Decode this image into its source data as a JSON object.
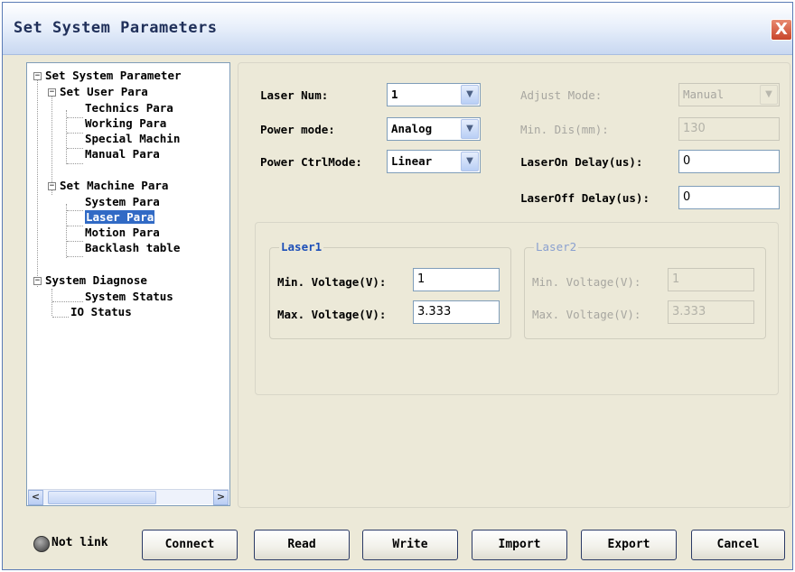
{
  "window": {
    "title": "Set System Parameters",
    "close_glyph": "X"
  },
  "tree": {
    "items": [
      {
        "label": "Set System Parameter"
      },
      {
        "label": "Set User Para"
      },
      {
        "label": "Technics Para"
      },
      {
        "label": "Working Para"
      },
      {
        "label": "Special Machin"
      },
      {
        "label": "Manual Para"
      },
      {
        "label": "Set Machine Para"
      },
      {
        "label": "System Para"
      },
      {
        "label": "Laser Para"
      },
      {
        "label": "Motion Para"
      },
      {
        "label": "Backlash table"
      },
      {
        "label": "System Diagnose"
      },
      {
        "label": "System Status"
      },
      {
        "label": "IO Status"
      }
    ],
    "selected": "Laser Para",
    "expander_glyph": "−",
    "scroll_left": "<",
    "scroll_right": ">"
  },
  "params": {
    "laser_num": {
      "label": "Laser Num:",
      "value": "1"
    },
    "power_mode": {
      "label": "Power mode:",
      "value": "Analog"
    },
    "power_ctrl_mode": {
      "label": "Power CtrlMode:",
      "value": "Linear"
    },
    "adjust_mode": {
      "label": "Adjust Mode:",
      "value": "Manual"
    },
    "min_dis": {
      "label": "Min. Dis(mm):",
      "value": "130"
    },
    "laser_on_delay": {
      "label": "LaserOn Delay(us):",
      "value": "0"
    },
    "laser_off_delay": {
      "label": "LaserOff Delay(us):",
      "value": "0"
    },
    "combo_arrow": "▼"
  },
  "laser1": {
    "title": "Laser1",
    "min_label": "Min. Voltage(V):",
    "min_value": "1",
    "max_label": "Max. Voltage(V):",
    "max_value": "3.333"
  },
  "laser2": {
    "title": "Laser2",
    "min_label": "Min. Voltage(V):",
    "min_value": "1",
    "max_label": "Max. Voltage(V):",
    "max_value": "3.333"
  },
  "footer": {
    "status": "Not link",
    "buttons": {
      "connect": "Connect",
      "read": "Read",
      "write": "Write",
      "import": "Import",
      "export": "Export",
      "cancel": "Cancel"
    }
  }
}
